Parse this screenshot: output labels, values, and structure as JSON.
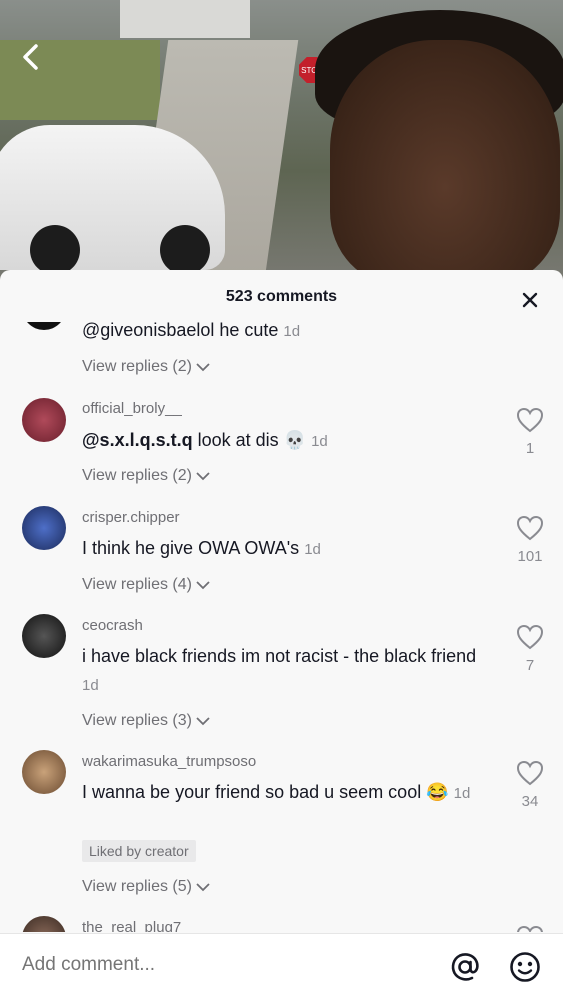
{
  "video": {
    "stop_sign": "STOP"
  },
  "sheet": {
    "comment_count": "523 comments"
  },
  "comments": [
    {
      "username": "",
      "text": "@giveonisbaelol he cute",
      "time": "1d",
      "replies": "View replies (2)"
    },
    {
      "username": "official_broly__",
      "mention": "@s.x.l.q.s.t.q",
      "text": " look at dis 💀",
      "time": "1d",
      "likes": "1",
      "replies": "View replies (2)"
    },
    {
      "username": "crisper.chipper",
      "text": "I think he give OWA OWA's",
      "time": "1d",
      "likes": "101",
      "replies": "View replies (4)"
    },
    {
      "username": "ceocrash",
      "text": "i have black friends im not racist - the black friend",
      "time": "1d",
      "likes": "7",
      "replies": "View replies (3)"
    },
    {
      "username": "wakarimasuka_trumpsoso",
      "text": "I wanna be your friend so bad u seem cool 😂",
      "time": "1d",
      "likes": "34",
      "badge": "Liked by creator",
      "replies": "View replies (5)"
    },
    {
      "username": "the_real_plug7"
    }
  ],
  "input": {
    "placeholder": "Add comment..."
  },
  "colors": {
    "sheet_bg": "#f8f8f8",
    "text": "#161823",
    "secondary": "#6f6f74"
  }
}
